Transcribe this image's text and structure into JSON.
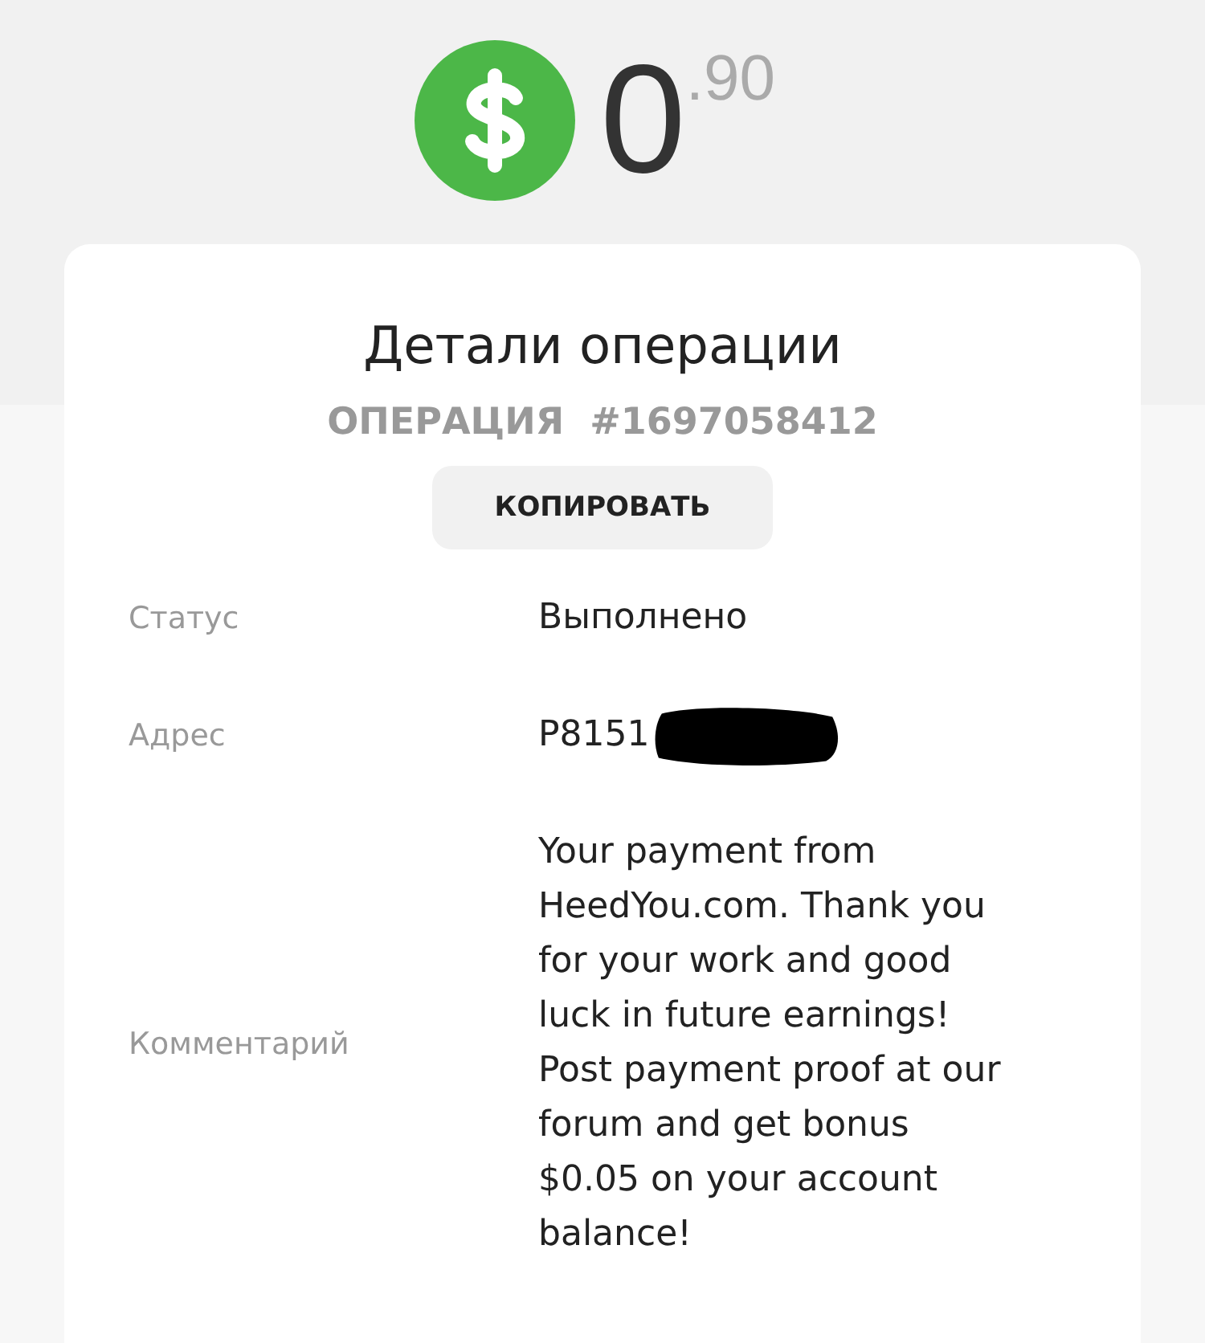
{
  "balance": {
    "whole": "0",
    "fraction": ".90"
  },
  "details": {
    "title": "Детали операции",
    "operation_label": "ОПЕРАЦИЯ",
    "operation_number": "#1697058412",
    "copy_button": "КОПИРОВАТЬ",
    "rows": [
      {
        "label": "Статус",
        "value": "Выполнено",
        "redacted": false
      },
      {
        "label": "Адрес",
        "value": "P8151",
        "redacted": true
      },
      {
        "label": "Комментарий",
        "value": "Your payment from HeedYou.com. Thank you for your work and good luck in future earnings! Post payment proof at our forum and get bonus $0.05 on your account balance!",
        "redacted": false
      }
    ]
  }
}
